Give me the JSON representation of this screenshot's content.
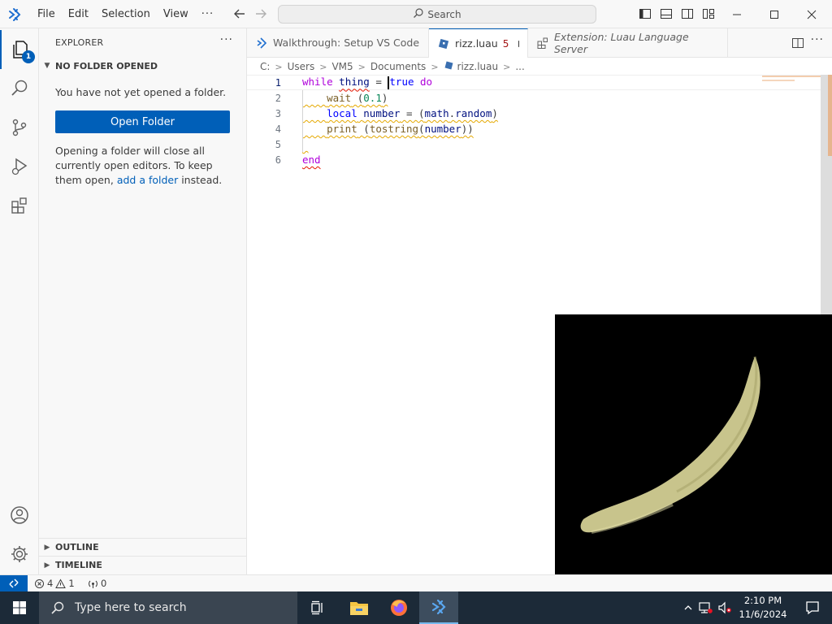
{
  "titlebar": {
    "menu": [
      "File",
      "Edit",
      "Selection",
      "View"
    ],
    "more": "···",
    "search_label": "Search"
  },
  "activity": {
    "explorer_badge": "1"
  },
  "sidebar": {
    "title": "EXPLORER",
    "more": "···",
    "section": "NO FOLDER OPENED",
    "no_folder_text": "You have not yet opened a folder.",
    "open_folder_button": "Open Folder",
    "note_before": "Opening a folder will close all currently open editors. To keep them open, ",
    "note_link": "add a folder",
    "note_after": " instead.",
    "outline": "OUTLINE",
    "timeline": "TIMELINE"
  },
  "tabs": [
    {
      "label": "Walkthrough: Setup VS Code"
    },
    {
      "label": "rizz.luau",
      "problems": "5"
    },
    {
      "label": "Extension: Luau Language Server"
    }
  ],
  "breadcrumb": [
    "C:",
    "Users",
    "VM5",
    "Documents",
    "rizz.luau",
    "..."
  ],
  "editor": {
    "line_numbers": [
      "1",
      "2",
      "3",
      "4",
      "5",
      "6"
    ],
    "code": {
      "l1_kw": "while",
      "l1_var": "thing",
      "l1_eq": " = ",
      "l1_true": "true",
      "l1_do": "do",
      "l2_fn": "wait",
      "l2_paren_open": " (",
      "l2_num": "0.1",
      "l2_paren_close": ")",
      "l3_kw": "local",
      "l3_var": "number",
      "l3_rest_a": " = (",
      "l3_math": "math",
      "l3_dot": ".",
      "l3_random": "random",
      "l3_close": ")",
      "l4_fn": "print",
      "l4_open": " (",
      "l4_tostring": "tostring",
      "l4_open2": "(",
      "l4_var": "number",
      "l4_close": "))",
      "l6_kw": "end"
    }
  },
  "statusbar": {
    "errors": "4",
    "warnings": "1",
    "ports": "0"
  },
  "taskbar": {
    "search_placeholder": "Type here to search",
    "time": "2:10 PM",
    "date": "11/6/2024"
  },
  "colors": {
    "accent": "#005fb8",
    "taskbar": "#1c2a38",
    "keyword": "#af00db",
    "function": "#795e26",
    "variable": "#001080",
    "number": "#098658",
    "warning_squiggle": "#e5a800"
  }
}
